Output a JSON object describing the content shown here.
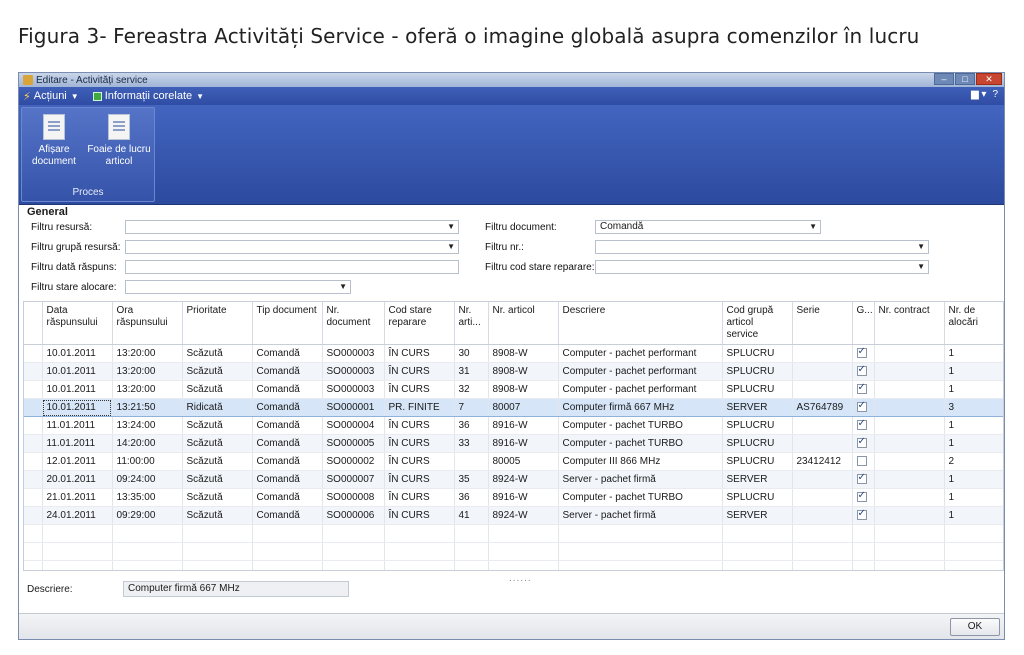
{
  "caption": "Figura 3- Fereastra Activități Service - oferă o imagine globală asupra comenzilor în lucru",
  "window": {
    "title": "Editare - Activități service",
    "minimize": "–",
    "maximize": "□",
    "close": "✕"
  },
  "menu": {
    "actions": "Acțiuni",
    "related": "Informații corelate",
    "right_view": "▆ ▾",
    "help": "?"
  },
  "ribbon": {
    "show_doc_line1": "Afișare",
    "show_doc_line2": "document",
    "worksheet_line1": "Foaie de lucru",
    "worksheet_line2": "articol",
    "group_name": "Proces"
  },
  "general": {
    "title": "General",
    "filter_resource_label": "Filtru resursă:",
    "filter_resource_value": "",
    "filter_resource_group_label": "Filtru grupă resursă:",
    "filter_resource_group_value": "",
    "filter_response_date_label": "Filtru dată răspuns:",
    "filter_response_date_value": "",
    "filter_alloc_status_label": "Filtru stare alocare:",
    "filter_alloc_status_value": "",
    "filter_document_label": "Filtru document:",
    "filter_document_value": "Comandă",
    "filter_no_label": "Filtru nr.:",
    "filter_no_value": "",
    "filter_repair_status_label": "Filtru cod stare reparare:",
    "filter_repair_status_value": ""
  },
  "grid": {
    "headers": {
      "c0": "Data răspunsului",
      "c1": "Ora răspunsului",
      "c2": "Prioritate",
      "c3": "Tip document",
      "c4": "Nr. document",
      "c5": "Cod stare reparare",
      "c6": "Nr. arti...",
      "c7": "Nr. articol",
      "c8": "Descriere",
      "c9": "Cod grupă articol service",
      "c10": "Serie",
      "c11": "G...",
      "c12": "Nr. contract",
      "c13": "Nr. de alocări"
    },
    "rows": [
      {
        "date": "10.01.2011",
        "time": "13:20:00",
        "prio": "Scăzută",
        "doctype": "Comandă",
        "docno": "SO000003",
        "status": "ÎN CURS",
        "line": "30",
        "item": "8908-W",
        "desc": "Computer - pachet performant",
        "group": "SPLUCRU",
        "serial": "",
        "warranty": true,
        "contract": "",
        "alloc": "1"
      },
      {
        "date": "10.01.2011",
        "time": "13:20:00",
        "prio": "Scăzută",
        "doctype": "Comandă",
        "docno": "SO000003",
        "status": "ÎN CURS",
        "line": "31",
        "item": "8908-W",
        "desc": "Computer - pachet performant",
        "group": "SPLUCRU",
        "serial": "",
        "warranty": true,
        "contract": "",
        "alloc": "1"
      },
      {
        "date": "10.01.2011",
        "time": "13:20:00",
        "prio": "Scăzută",
        "doctype": "Comandă",
        "docno": "SO000003",
        "status": "ÎN CURS",
        "line": "32",
        "item": "8908-W",
        "desc": "Computer - pachet performant",
        "group": "SPLUCRU",
        "serial": "",
        "warranty": true,
        "contract": "",
        "alloc": "1"
      },
      {
        "date": "10.01.2011",
        "time": "13:21:50",
        "prio": "Ridicată",
        "doctype": "Comandă",
        "docno": "SO000001",
        "status": "PR. FINITE",
        "line": "7",
        "item": "80007",
        "desc": "Computer firmă 667 MHz",
        "group": "SERVER",
        "serial": "AS764789",
        "warranty": true,
        "contract": "",
        "alloc": "3"
      },
      {
        "date": "11.01.2011",
        "time": "13:24:00",
        "prio": "Scăzută",
        "doctype": "Comandă",
        "docno": "SO000004",
        "status": "ÎN CURS",
        "line": "36",
        "item": "8916-W",
        "desc": "Computer - pachet TURBO",
        "group": "SPLUCRU",
        "serial": "",
        "warranty": true,
        "contract": "",
        "alloc": "1"
      },
      {
        "date": "11.01.2011",
        "time": "14:20:00",
        "prio": "Scăzută",
        "doctype": "Comandă",
        "docno": "SO000005",
        "status": "ÎN CURS",
        "line": "33",
        "item": "8916-W",
        "desc": "Computer - pachet TURBO",
        "group": "SPLUCRU",
        "serial": "",
        "warranty": true,
        "contract": "",
        "alloc": "1"
      },
      {
        "date": "12.01.2011",
        "time": "11:00:00",
        "prio": "Scăzută",
        "doctype": "Comandă",
        "docno": "SO000002",
        "status": "ÎN CURS",
        "line": "",
        "item": "80005",
        "desc": "Computer III 866 MHz",
        "group": "SPLUCRU",
        "serial": "23412412",
        "warranty": false,
        "contract": "",
        "alloc": "2"
      },
      {
        "date": "20.01.2011",
        "time": "09:24:00",
        "prio": "Scăzută",
        "doctype": "Comandă",
        "docno": "SO000007",
        "status": "ÎN CURS",
        "line": "35",
        "item": "8924-W",
        "desc": "Server - pachet firmă",
        "group": "SERVER",
        "serial": "",
        "warranty": true,
        "contract": "",
        "alloc": "1"
      },
      {
        "date": "21.01.2011",
        "time": "13:35:00",
        "prio": "Scăzută",
        "doctype": "Comandă",
        "docno": "SO000008",
        "status": "ÎN CURS",
        "line": "36",
        "item": "8916-W",
        "desc": "Computer - pachet TURBO",
        "group": "SPLUCRU",
        "serial": "",
        "warranty": true,
        "contract": "",
        "alloc": "1"
      },
      {
        "date": "24.01.2011",
        "time": "09:29:00",
        "prio": "Scăzută",
        "doctype": "Comandă",
        "docno": "SO000006",
        "status": "ÎN CURS",
        "line": "41",
        "item": "8924-W",
        "desc": "Server - pachet firmă",
        "group": "SERVER",
        "serial": "",
        "warranty": true,
        "contract": "",
        "alloc": "1"
      }
    ],
    "selected_index": 3
  },
  "splitter": "......",
  "description": {
    "label": "Descriere:",
    "value": "Computer firmă 667 MHz"
  },
  "footer": {
    "ok": "OK"
  },
  "dropdown_glyph": "▼"
}
